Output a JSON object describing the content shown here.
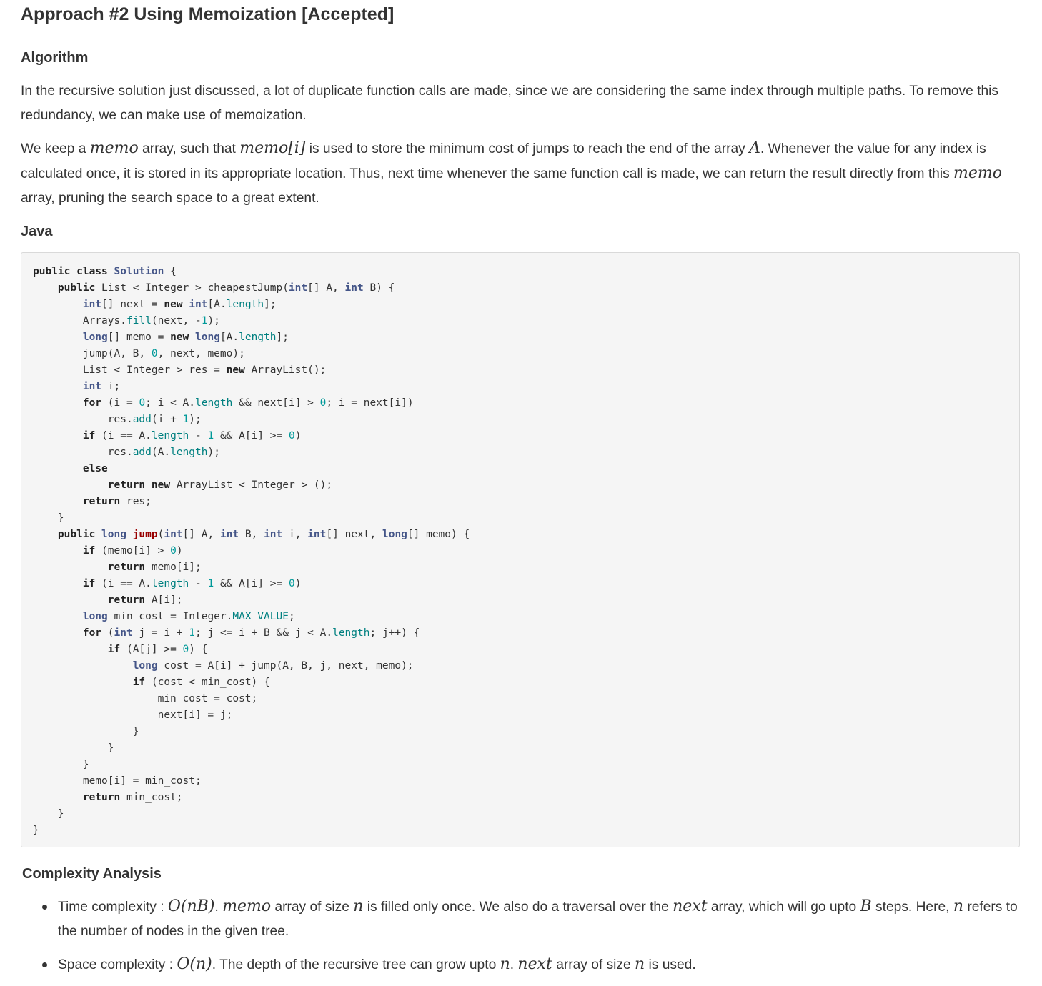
{
  "title": "Approach #2 Using Memoization [Accepted]",
  "algorithm_heading": "Algorithm",
  "para1": "In the recursive solution just discussed, a lot of duplicate function calls are made, since we are considering the same index through multiple paths. To remove this redundancy, we can make use of memoization.",
  "para2": {
    "t1": "We keep a ",
    "m1": "memo",
    "t2": " array, such that ",
    "m2": "memo[i]",
    "t3": " is used to store the minimum cost of jumps to reach the end of the array ",
    "m3": "A",
    "t4": ". Whenever the value for any index is calculated once, it is stored in its appropriate location. Thus, next time whenever the same function call is made, we can return the result directly from this ",
    "m4": "memo",
    "t5": " array, pruning the search space to a great extent."
  },
  "java_heading": "Java",
  "complexity_heading": "Complexity Analysis",
  "time": {
    "t1": "Time complexity : ",
    "m1": "O(nB)",
    "t2": ". ",
    "m2": "memo",
    "t3": " array of size ",
    "m3": "n",
    "t4": " is filled only once. We also do a traversal over the ",
    "m4": "next",
    "t5": " array, which will go upto ",
    "m5": "B",
    "t6": " steps. Here, ",
    "m6": "n",
    "t7": " refers to the number of nodes in the given tree."
  },
  "space": {
    "t1": "Space complexity : ",
    "m1": "O(n)",
    "t2": ". The depth of the recursive tree can grow upto ",
    "m2": "n",
    "t3": ". ",
    "m3": "next",
    "t4": " array of size ",
    "m4": "n",
    "t5": " is used."
  }
}
